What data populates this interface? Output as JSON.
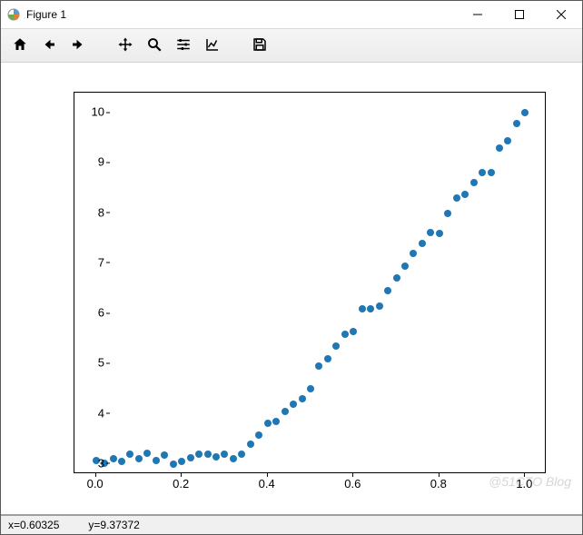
{
  "window": {
    "title": "Figure 1"
  },
  "toolbar": {
    "home": "Home",
    "back": "Back",
    "forward": "Forward",
    "pan": "Pan",
    "zoom": "Zoom",
    "subplots": "Configure subplots",
    "axes": "Edit axes",
    "save": "Save"
  },
  "status": {
    "x_label": "x=",
    "x_value": "0.60325",
    "y_label": "y=",
    "y_value": "9.37372"
  },
  "watermark": "@51CTO Blog",
  "colors": {
    "point": "#1f77b4"
  },
  "chart_data": {
    "type": "scatter",
    "title": "",
    "xlabel": "",
    "ylabel": "",
    "xlim": [
      -0.05,
      1.05
    ],
    "ylim": [
      2.8,
      10.4
    ],
    "xticks": [
      0.0,
      0.2,
      0.4,
      0.6,
      0.8,
      1.0
    ],
    "yticks": [
      3,
      4,
      5,
      6,
      7,
      8,
      9,
      10
    ],
    "x": [
      0.0,
      0.02,
      0.04,
      0.06,
      0.08,
      0.1,
      0.12,
      0.14,
      0.16,
      0.18,
      0.2,
      0.22,
      0.24,
      0.26,
      0.28,
      0.3,
      0.32,
      0.34,
      0.36,
      0.38,
      0.4,
      0.42,
      0.44,
      0.46,
      0.48,
      0.5,
      0.52,
      0.54,
      0.56,
      0.58,
      0.6,
      0.62,
      0.64,
      0.66,
      0.68,
      0.7,
      0.72,
      0.74,
      0.76,
      0.78,
      0.8,
      0.82,
      0.84,
      0.86,
      0.88,
      0.9,
      0.92,
      0.94,
      0.96,
      0.98,
      1.0
    ],
    "y": [
      3.08,
      3.02,
      3.1,
      3.05,
      3.2,
      3.1,
      3.22,
      3.08,
      3.18,
      3.0,
      3.05,
      3.12,
      3.2,
      3.2,
      3.15,
      3.2,
      3.1,
      3.2,
      3.4,
      3.58,
      3.82,
      3.85,
      4.05,
      4.2,
      4.3,
      4.5,
      4.95,
      5.1,
      5.35,
      5.58,
      5.65,
      6.1,
      6.1,
      6.15,
      6.45,
      6.7,
      6.95,
      7.2,
      7.4,
      7.62,
      7.6,
      8.0,
      8.3,
      8.38,
      8.6,
      8.8,
      8.8,
      9.3,
      9.45,
      9.78,
      10.0
    ]
  }
}
